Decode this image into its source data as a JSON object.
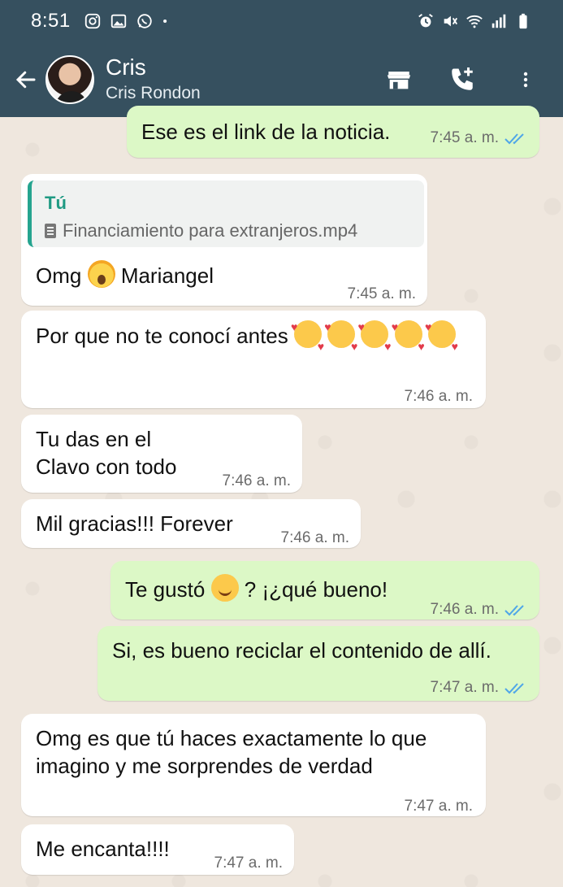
{
  "status_bar": {
    "time": "8:51",
    "left_icons": [
      "instagram-icon",
      "gallery-icon",
      "whatsapp-icon",
      "dot-icon"
    ],
    "right_icons": [
      "alarm-icon",
      "mute-icon",
      "wifi-icon",
      "signal-icon",
      "battery-icon"
    ]
  },
  "header": {
    "contact_name": "Cris",
    "contact_subtitle": "Cris Rondon",
    "actions": [
      "store-icon",
      "add-call-icon",
      "more-icon"
    ]
  },
  "messages": [
    {
      "direction": "out",
      "text": "Ese es el link de la noticia.",
      "time": "7:45 a. m.",
      "read": true
    },
    {
      "direction": "in",
      "quote_author": "Tú",
      "quote_file": "Financiamiento para extranjeros.mp4",
      "text_before": "Omg",
      "text_after": "Mariangel",
      "time": "7:45 a. m."
    },
    {
      "direction": "in",
      "text": "Por que no te conocí antes",
      "time": "7:46 a. m."
    },
    {
      "direction": "in",
      "text_line1": "Tu das en el",
      "text_line2": "Clavo con todo",
      "time": "7:46 a. m."
    },
    {
      "direction": "in",
      "text": "Mil gracias!!! Forever",
      "time": "7:46 a. m."
    },
    {
      "direction": "out",
      "text_before": "Te gustó",
      "text_after": "? ¡¿qué bueno!",
      "time": "7:46 a. m.",
      "read": true
    },
    {
      "direction": "out",
      "text": "Si, es bueno reciclar el contenido de allí.",
      "time": "7:47 a. m.",
      "read": true
    },
    {
      "direction": "in",
      "text_line1": "Omg es que tú haces exactamente lo que",
      "text_line2": "imagino y me sorprendes de verdad",
      "time": "7:47 a. m."
    },
    {
      "direction": "in",
      "text": "Me encanta!!!!",
      "time": "7:47 a. m."
    }
  ],
  "colors": {
    "header_bg": "#36505f",
    "chat_bg": "#efe7de",
    "outgoing_bubble": "#dcf8c6",
    "incoming_bubble": "#ffffff",
    "read_ticks": "#4fa6e8",
    "quote_accent": "#25a48f"
  }
}
